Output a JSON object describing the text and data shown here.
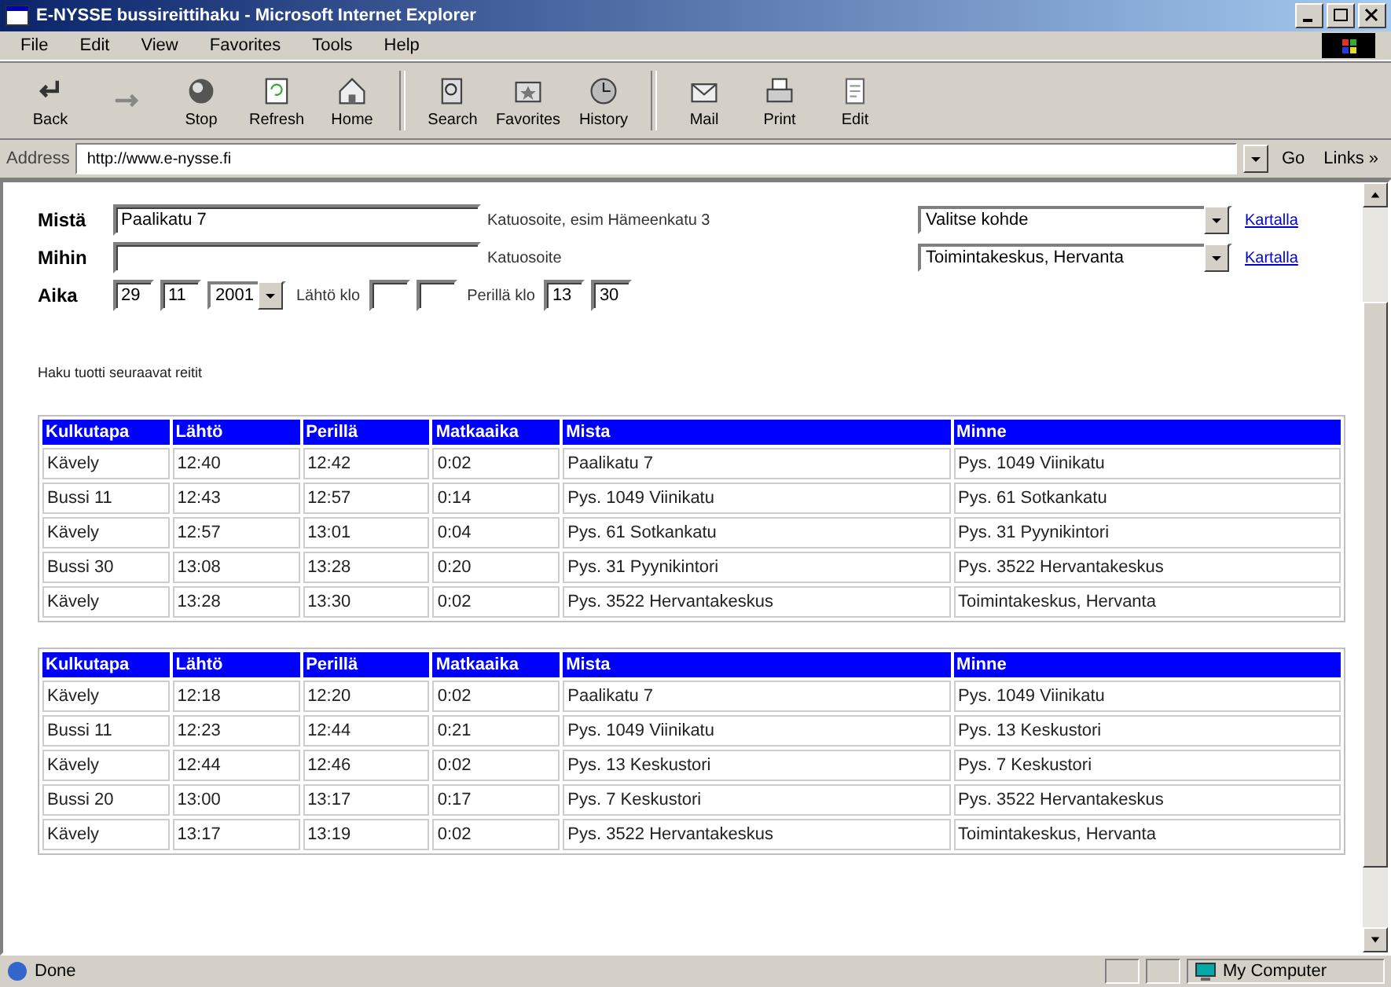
{
  "window": {
    "title": "E-NYSSE bussireittihaku - Microsoft Internet Explorer"
  },
  "menu": [
    "File",
    "Edit",
    "View",
    "Favorites",
    "Tools",
    "Help"
  ],
  "toolbar": [
    {
      "label": "Back",
      "kind": "back"
    },
    {
      "kind": "forward"
    },
    {
      "label": "Stop",
      "kind": "stop"
    },
    {
      "label": "Refresh",
      "kind": "refresh"
    },
    {
      "label": "Home",
      "kind": "home"
    },
    {
      "label": "Search",
      "kind": "search"
    },
    {
      "label": "Favorites",
      "kind": "favorites"
    },
    {
      "label": "History",
      "kind": "history"
    },
    {
      "label": "Mail",
      "kind": "mail"
    },
    {
      "label": "Print",
      "kind": "print"
    },
    {
      "label": "Edit",
      "kind": "edit"
    }
  ],
  "address_bar": {
    "label": "Address",
    "value": "http://www.e-nysse.fi",
    "go": "Go",
    "links": "Links »"
  },
  "form": {
    "from": {
      "label": "Mistä",
      "value": "Paalikatu 7",
      "hint": "Katuosoite, esim Hämeenkatu 3",
      "select": "Valitse kohde",
      "map_link": "Kartalla"
    },
    "to": {
      "label": "Mihin",
      "hint": "Katuosoite",
      "select": "Toimintakeskus, Hervanta",
      "map_link": "Kartalla"
    },
    "time": {
      "label": "Aika",
      "day": "29",
      "month": "11",
      "year": "2001",
      "depart_label": "Lähtö klo",
      "arrive_label": "Perillä klo",
      "arrive_hour": "13",
      "arrive_min": "30"
    }
  },
  "result_text": "Haku tuotti seuraavat reitit",
  "tables": [
    {
      "columns": [
        "Kulkutapa",
        "Lähtö",
        "Perillä",
        "Matkaaika",
        "Mista",
        "Minne"
      ],
      "rows": [
        [
          "Kävely",
          "12:40",
          "12:42",
          "0:02",
          "Paalikatu 7",
          "Pys. 1049 Viinikatu"
        ],
        [
          "Bussi 11",
          "12:43",
          "12:57",
          "0:14",
          "Pys. 1049 Viinikatu",
          "Pys. 61 Sotkankatu"
        ],
        [
          "Kävely",
          "12:57",
          "13:01",
          "0:04",
          "Pys. 61 Sotkankatu",
          "Pys. 31 Pyynikintori"
        ],
        [
          "Bussi 30",
          "13:08",
          "13:28",
          "0:20",
          "Pys. 31 Pyynikintori",
          "Pys. 3522 Hervantakeskus"
        ],
        [
          "Kävely",
          "13:28",
          "13:30",
          "0:02",
          "Pys. 3522 Hervantakeskus",
          "Toimintakeskus, Hervanta"
        ]
      ]
    },
    {
      "columns": [
        "Kulkutapa",
        "Lähtö",
        "Perillä",
        "Matkaaika",
        "Mista",
        "Minne"
      ],
      "rows": [
        [
          "Kävely",
          "12:18",
          "12:20",
          "0:02",
          "Paalikatu 7",
          "Pys. 1049 Viinikatu"
        ],
        [
          "Bussi 11",
          "12:23",
          "12:44",
          "0:21",
          "Pys. 1049 Viinikatu",
          "Pys. 13 Keskustori"
        ],
        [
          "Kävely",
          "12:44",
          "12:46",
          "0:02",
          "Pys. 13 Keskustori",
          "Pys. 7 Keskustori"
        ],
        [
          "Bussi 20",
          "13:00",
          "13:17",
          "0:17",
          "Pys. 7 Keskustori",
          "Pys. 3522 Hervantakeskus"
        ],
        [
          "Kävely",
          "13:17",
          "13:19",
          "0:02",
          "Pys. 3522 Hervantakeskus",
          "Toimintakeskus, Hervanta"
        ]
      ]
    }
  ],
  "status_bar": {
    "text": "Done",
    "zone": "My Computer"
  }
}
